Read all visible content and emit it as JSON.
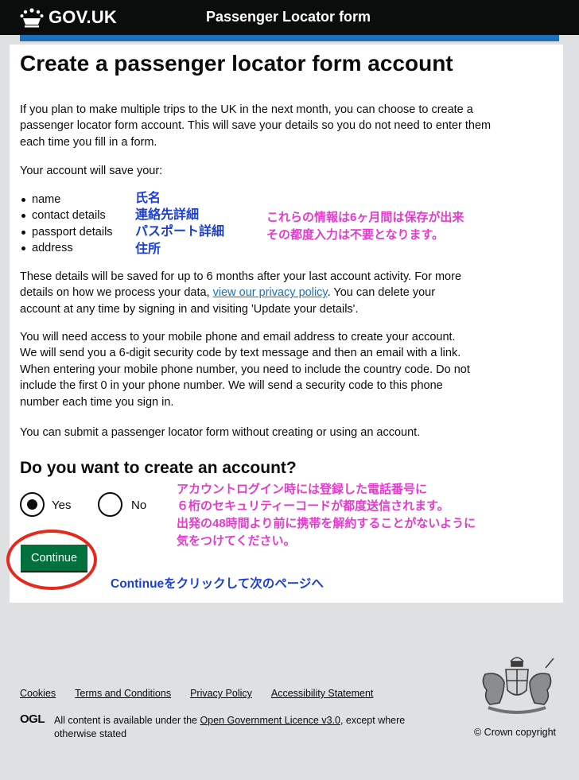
{
  "header": {
    "brand": "GOV.UK",
    "service_name": "Passenger Locator form",
    "crown_icon": "crown-icon"
  },
  "main": {
    "title": "Create a passenger locator form account",
    "intro": "If you plan to make multiple trips to the UK in the next month, you can choose to create a passenger locator form account. This will save your details so you do not need to enter them each time you fill in a form.",
    "save_heading": "Your account will save your:",
    "saved_items": [
      {
        "label": "name",
        "jp": "氏名"
      },
      {
        "label": "contact details",
        "jp": "連絡先詳細"
      },
      {
        "label": "passport details",
        "jp": "パスポート詳細"
      },
      {
        "label": "address",
        "jp": "住所"
      }
    ],
    "note_saved_line1": "これらの情報は6ヶ月間は保存が出来",
    "note_saved_line2": "その都度入力は不要となります。",
    "privacy_before": "These details will be saved for up to 6 months after your last account activity. For more details on how we process your data, ",
    "privacy_link": "view our privacy policy",
    "privacy_after": ". You can delete your account at any time by signing in and visiting 'Update your details'.",
    "access_text": "You will need access to your mobile phone and email address to create your account. We will send you a 6-digit security code by text message and then an email with a link. When entering your mobile phone number, you need to include the country code. Do not include the first 0 in your phone number. We will send a security code to this phone number each time you sign in.",
    "submit_text": "You can submit a passenger locator form without creating or using an account.",
    "question": "Do you want to create an account?",
    "options": [
      {
        "label": "Yes",
        "checked": true
      },
      {
        "label": "No",
        "checked": false
      }
    ],
    "note_security": [
      "アカウントログイン時には登録した電話番号に",
      "６桁のセキュリティーコードが都度送信されます。",
      "出発の48時間より前に携帯を解約することがないように",
      "気をつけてください。"
    ],
    "continue_label": "Continue",
    "note_continue": "Continueをクリックして次のページへ"
  },
  "footer": {
    "links": [
      "Cookies",
      "Terms and Conditions",
      "Privacy Policy",
      "Accessibility Statement"
    ],
    "ogl": "OGL",
    "licence_before": "All content is available under the ",
    "licence_link": "Open Government Licence v3.0",
    "licence_after": ", except where otherwise stated",
    "copyright": "© Crown copyright",
    "crest_icon": "royal-coat-of-arms-icon"
  },
  "colors": {
    "header_bg": "#0b0c0c",
    "accent_blue": "#1d70b8",
    "button_green": "#00703c",
    "annotation_pink": "#e33ccc",
    "annotation_blue": "#1a3fd6",
    "annotation_red": "#e6291d",
    "footer_bg": "#dee0e2"
  }
}
